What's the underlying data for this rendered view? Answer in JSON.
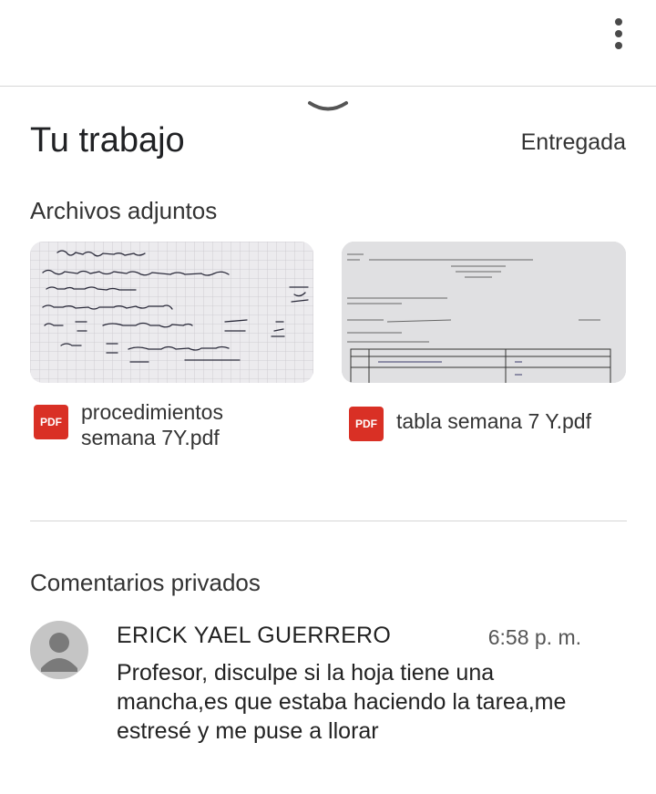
{
  "header": {
    "menu_icon": "more-vert-icon",
    "collapse_icon": "chevron-down-icon"
  },
  "work": {
    "title": "Tu trabajo",
    "status": "Entregada"
  },
  "attachments": {
    "label": "Archivos adjuntos",
    "files": [
      {
        "name": "procedimientos semana 7Y.pdf",
        "type": "PDF"
      },
      {
        "name": "tabla semana 7 Y.pdf",
        "type": "PDF"
      }
    ]
  },
  "comments": {
    "label": "Comentarios privados",
    "items": [
      {
        "author": "ERICK YAEL GUERRERO",
        "time": "6:58 p. m.",
        "text": "Profesor, disculpe si la hoja tiene una mancha,es que estaba haciendo la tarea,me estresé y me puse a llorar"
      }
    ]
  },
  "colors": {
    "pdf_red": "#d93025",
    "divider": "#d6d6d6",
    "avatar_gray": "#c5c5c5"
  }
}
